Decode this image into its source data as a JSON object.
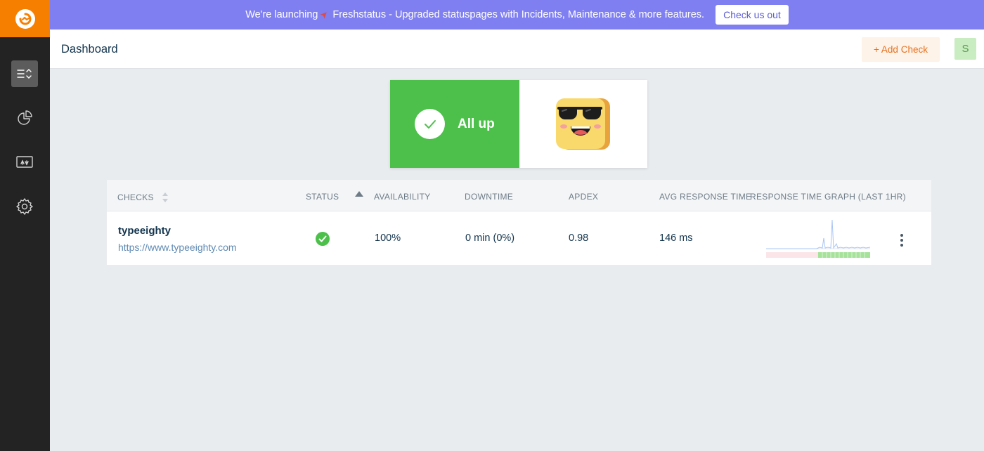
{
  "sidebar": {
    "logo": "freshping-logo",
    "items": [
      {
        "name": "dashboard",
        "icon": "checks-list-icon",
        "active": true
      },
      {
        "name": "reports",
        "icon": "pie-chart-icon",
        "active": false
      },
      {
        "name": "statuspage",
        "icon": "status-page-icon",
        "active": false
      },
      {
        "name": "settings",
        "icon": "gear-icon",
        "active": false
      }
    ]
  },
  "banner": {
    "text_before": "We're launching",
    "rocket_icon": "rocket-icon",
    "text_after": "Freshstatus - Upgraded statuspages with Incidents, Maintenance & more features.",
    "cta_label": "Check us out",
    "background": "#7f7ff2"
  },
  "header": {
    "title": "Dashboard",
    "add_check_label": "+ Add Check",
    "avatar_initial": "S"
  },
  "status": {
    "label": "All up",
    "color": "#4cc04a",
    "emoji": "cool-sunglasses-emoji"
  },
  "table": {
    "columns": {
      "checks": "CHECKS",
      "status": "STATUS",
      "availability": "AVAILABILITY",
      "downtime": "DOWNTIME",
      "apdex": "APDEX",
      "avg_response": "AVG RESPONSE TIME",
      "graph": "RESPONSE TIME GRAPH (LAST 1HR)"
    },
    "rows": [
      {
        "name": "typeeighty",
        "url": "https://www.typeeighty.com",
        "status": "up",
        "availability": "100%",
        "downtime": "0 min (0%)",
        "apdex": "0.98",
        "avg_response": "146 ms"
      }
    ]
  }
}
